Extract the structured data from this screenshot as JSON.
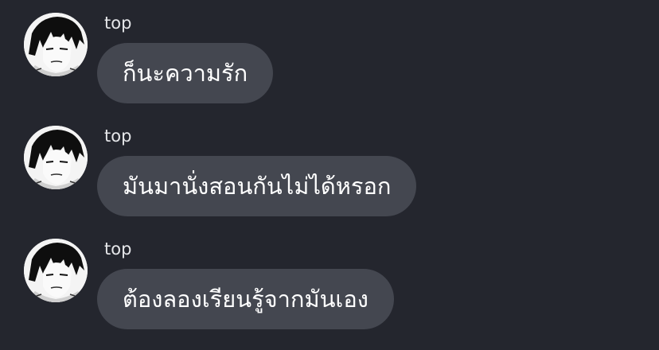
{
  "messages": [
    {
      "sender": "top",
      "text": "ก็นะความรัก"
    },
    {
      "sender": "top",
      "text": "มันมานั่งสอนกันไม่ได้หรอก"
    },
    {
      "sender": "top",
      "text": "ต้องลองเรียนรู้จากมันเอง"
    }
  ],
  "colors": {
    "background": "#24262e",
    "bubble": "#444750",
    "text": "#ffffff",
    "sender": "#e6e7ea"
  },
  "icons": {
    "avatar": "avatar-manga-portrait"
  }
}
